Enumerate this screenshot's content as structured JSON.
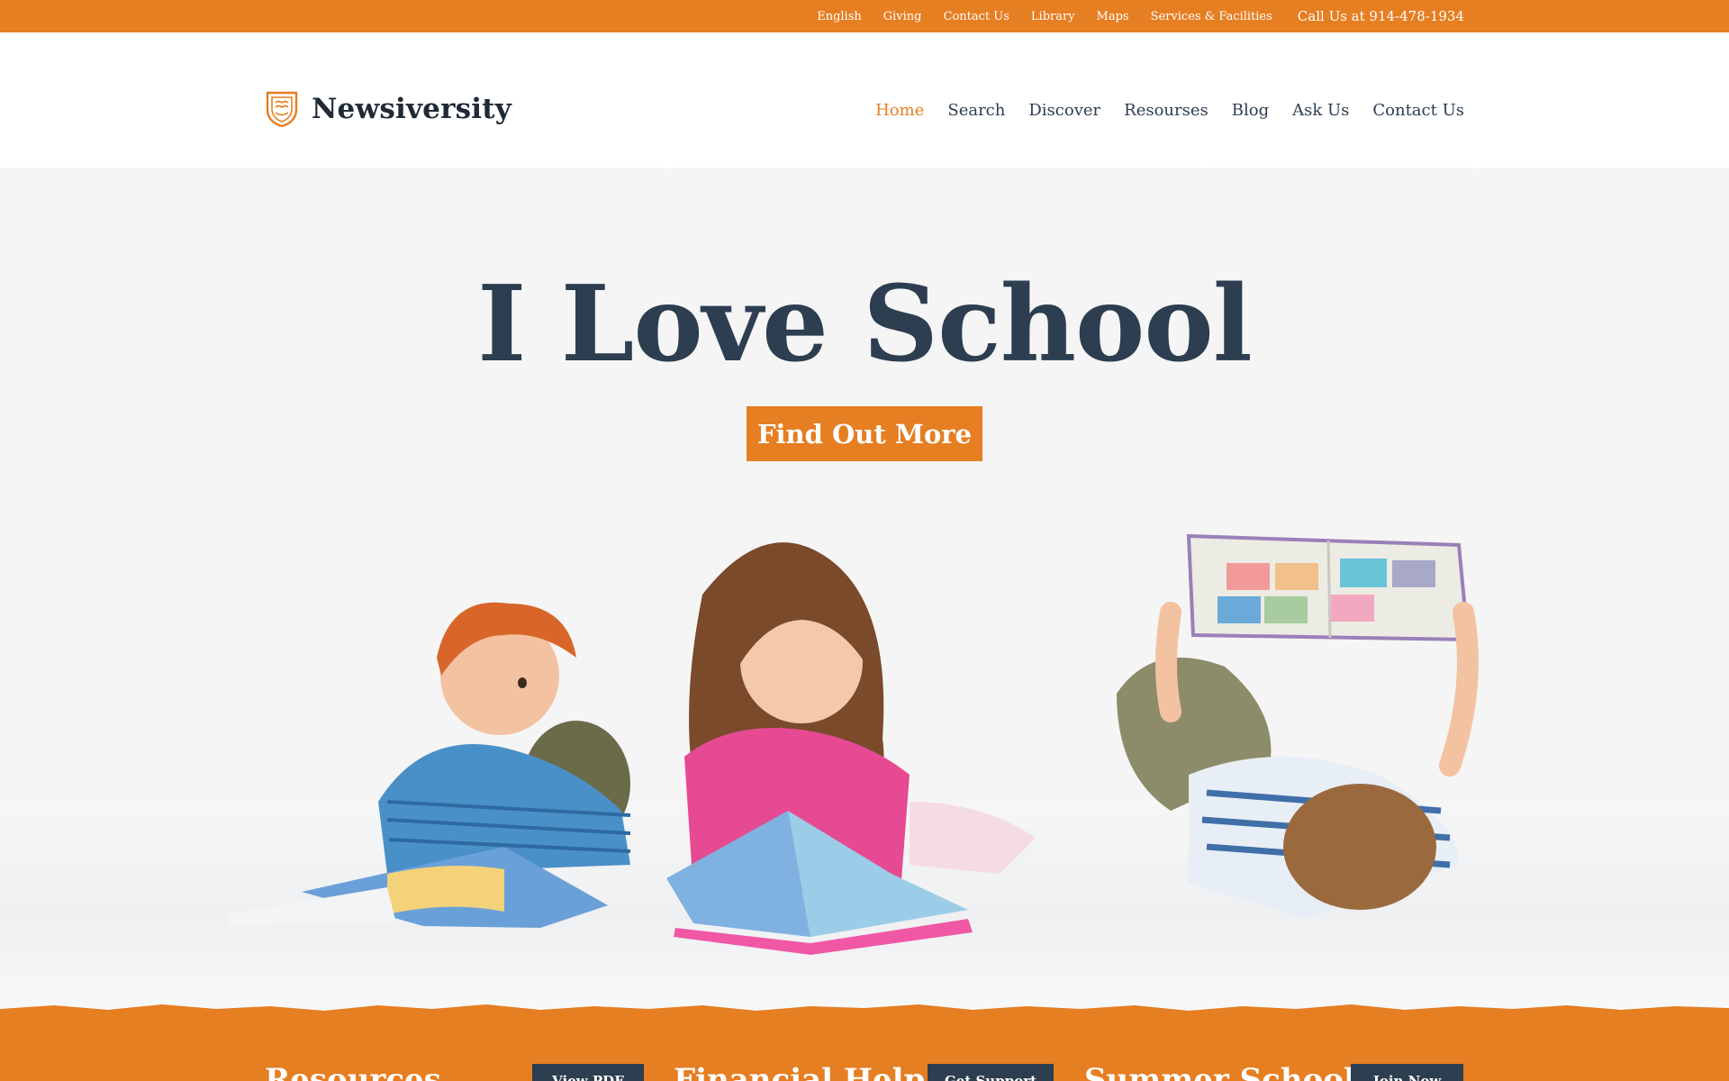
{
  "topbar": {
    "links": [
      "English",
      "Giving",
      "Contact Us",
      "Library",
      "Maps",
      "Services & Facilities"
    ],
    "phone": "Call Us at 914-478-1934"
  },
  "header": {
    "logo_text": "Newsiversity",
    "logo_icon": "shield-crest-icon",
    "nav": [
      "Home",
      "Search",
      "Discover",
      "Resourses",
      "Blog",
      "Ask Us",
      "Contact Us"
    ],
    "active_nav": "Home"
  },
  "hero": {
    "title": "I Love School",
    "cta": "Find Out More"
  },
  "cards": [
    {
      "title": "Resources",
      "button": "View PDF"
    },
    {
      "title": "Financial Help",
      "button": "Get Support"
    },
    {
      "title": "Summer School",
      "button": "Join Now"
    }
  ],
  "colors": {
    "accent": "#e67e22",
    "navy": "#2c3e50",
    "background": "#f5f5f5"
  }
}
